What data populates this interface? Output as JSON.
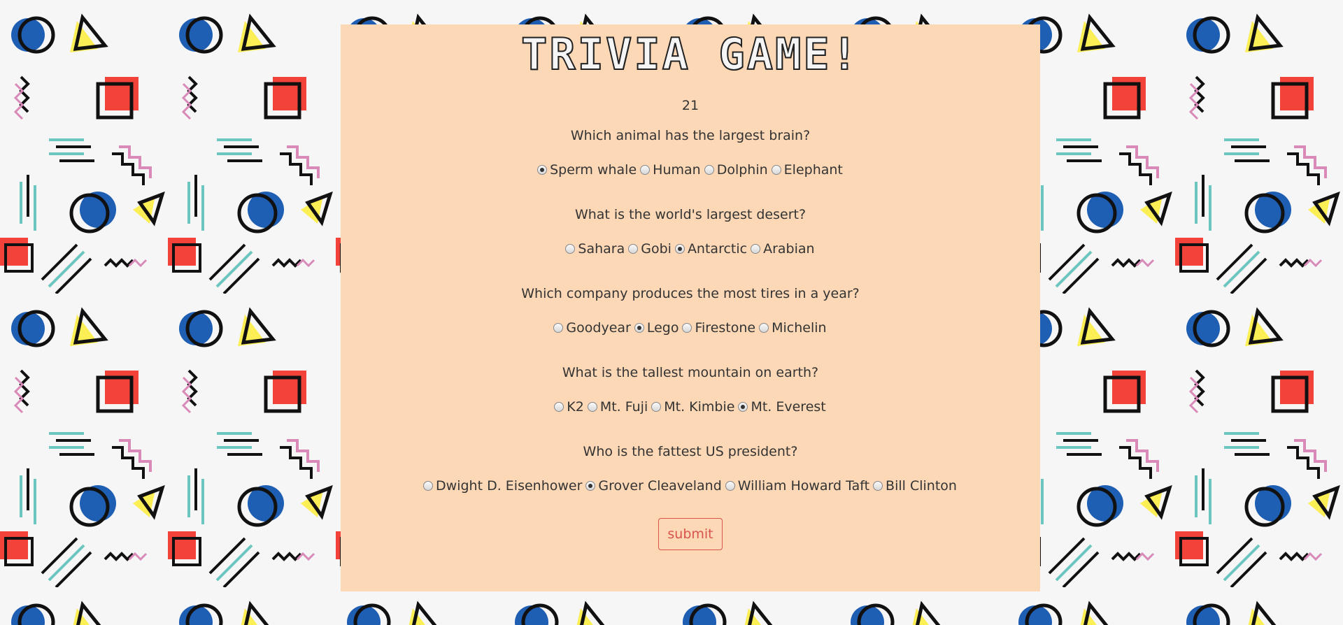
{
  "title": "TRIVIA GAME!",
  "timer": "21",
  "questions": [
    {
      "text": "Which animal has the largest brain?",
      "answers": [
        "Sperm whale",
        "Human",
        "Dolphin",
        "Elephant"
      ],
      "selected": 0
    },
    {
      "text": "What is the world's largest desert?",
      "answers": [
        "Sahara",
        "Gobi",
        "Antarctic",
        "Arabian"
      ],
      "selected": 2
    },
    {
      "text": "Which company produces the most tires in a year?",
      "answers": [
        "Goodyear",
        "Lego",
        "Firestone",
        "Michelin"
      ],
      "selected": 1
    },
    {
      "text": "What is the tallest mountain on earth?",
      "answers": [
        "K2",
        "Mt. Fuji",
        "Mt. Kimbie",
        "Mt. Everest"
      ],
      "selected": 3
    },
    {
      "text": "Who is the fattest US president?",
      "answers": [
        "Dwight D. Eisenhower",
        "Grover Cleaveland",
        "William Howard Taft",
        "Bill Clinton"
      ],
      "selected": 1
    }
  ],
  "submit_label": "submit",
  "colors": {
    "panel": "#fdd8b6",
    "submit_accent": "#d9534f",
    "pattern_blue": "#1e5fb4",
    "pattern_red": "#f2423a",
    "pattern_yellow": "#fcee55",
    "pattern_teal": "#6cc6c0",
    "pattern_pink": "#d98ab9"
  }
}
